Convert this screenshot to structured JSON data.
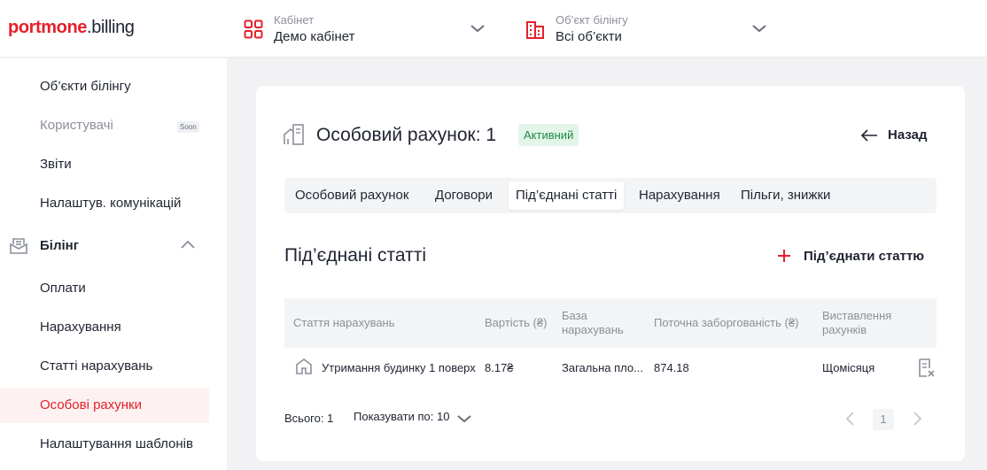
{
  "logo": {
    "part1": "port",
    "part2": "mone",
    "part3": ".billing"
  },
  "header": {
    "cabinet": {
      "label": "Кабінет",
      "value": "Демо кабінет",
      "icon": "grid-icon"
    },
    "billing_object": {
      "label": "Об’єкт білінгу",
      "value": "Всі об’єкти",
      "icon": "building-icon"
    }
  },
  "sidebar": {
    "items_top": [
      {
        "label": "Об’єкти білінгу"
      },
      {
        "label": "Користувачі",
        "badge": "Soon"
      },
      {
        "label": "Звіти"
      },
      {
        "label": "Налаштув. комунікацій"
      }
    ],
    "group": {
      "label": "Білінг",
      "icon": "billing-icon",
      "expanded": true
    },
    "items_group": [
      {
        "label": "Оплати"
      },
      {
        "label": "Нарахування"
      },
      {
        "label": "Статті нарахувань"
      },
      {
        "label": "Особові рахунки",
        "active": true
      },
      {
        "label": "Налаштування шаблонів"
      }
    ]
  },
  "account": {
    "title": "Особовий рахунок: 1",
    "status": "Активний",
    "back_label": "Назад"
  },
  "tabs": [
    {
      "label": "Особовий рахунок"
    },
    {
      "label": "Договори"
    },
    {
      "label": "Під’єднані статті",
      "active": true
    },
    {
      "label": "Нарахування"
    },
    {
      "label": "Пільги, знижки"
    }
  ],
  "section": {
    "title": "Під’єднані статті",
    "connect_label": "Під’єднати статтю"
  },
  "table": {
    "headers": {
      "article": "Стаття нарахувань",
      "cost": "Вартість (₴)",
      "base_1": "База",
      "base_2": "нарахувань",
      "debt": "Поточна заборгованість (₴)",
      "billing_1": "Виставлення",
      "billing_2": "рахунків"
    },
    "rows": [
      {
        "article": "Утримання будинку 1 поверх",
        "cost": "8.17₴",
        "base": "Загальна пло...",
        "debt": "874.18",
        "billing": "Щомісяця"
      }
    ]
  },
  "footer": {
    "total": "Всього: 1",
    "per_page_label": "Показувати по:",
    "per_page_value": "10",
    "current_page": "1"
  },
  "colors": {
    "accent": "#e4212b",
    "active_bg": "#fdf1f2",
    "badge_bg": "#e3f5e9",
    "badge_text": "#1f8a44"
  }
}
